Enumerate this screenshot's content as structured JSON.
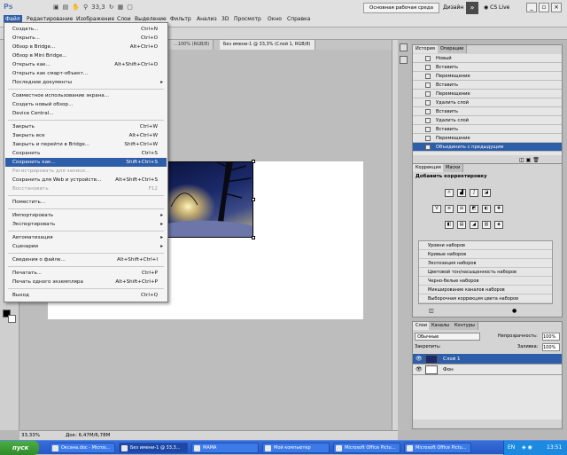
{
  "app": {
    "logo": "Ps",
    "zoom": "33,3",
    "workspace": "Основная рабочая среда",
    "design": "Дизайн",
    "cslive": "CS Live"
  },
  "menubar": [
    "Файл",
    "Редактирование",
    "Изображение",
    "Слои",
    "Выделение",
    "Фильтр",
    "Анализ",
    "3D",
    "Просмотр",
    "Окно",
    "Справка"
  ],
  "tabs": [
    "...100% (RGB/8)",
    "Без имени-1 @ 33,3% (Слой 1, RGB/8)"
  ],
  "status": {
    "zoom": "33,33%",
    "doc": "Док: 6,47M/6,78M"
  },
  "file_menu": [
    {
      "label": "Создать...",
      "shortcut": "Ctrl+N"
    },
    {
      "label": "Открыть...",
      "shortcut": "Ctrl+O"
    },
    {
      "label": "Обзор в Bridge...",
      "shortcut": "Alt+Ctrl+O"
    },
    {
      "label": "Обзор в Mini Bridge...",
      "shortcut": ""
    },
    {
      "label": "Открыть как...",
      "shortcut": "Alt+Shift+Ctrl+O"
    },
    {
      "label": "Открыть как смарт-объект...",
      "shortcut": ""
    },
    {
      "label": "Последние документы",
      "shortcut": "",
      "sub": "▸"
    },
    {
      "label": "Совместное использование экрана...",
      "shortcut": ""
    },
    {
      "label": "Создать новый обзор...",
      "shortcut": ""
    },
    {
      "label": "Device Central...",
      "shortcut": ""
    },
    {
      "label": "Закрыть",
      "shortcut": "Ctrl+W"
    },
    {
      "label": "Закрыть все",
      "shortcut": "Alt+Ctrl+W"
    },
    {
      "label": "Закрыть и перейти в Bridge...",
      "shortcut": "Shift+Ctrl+W"
    },
    {
      "label": "Сохранить",
      "shortcut": "Ctrl+S"
    },
    {
      "label": "Сохранить как...",
      "shortcut": "Shift+Ctrl+S"
    },
    {
      "label": "Регистрировать для записи...",
      "shortcut": ""
    },
    {
      "label": "Сохранить для Web и устройств...",
      "shortcut": "Alt+Shift+Ctrl+S"
    },
    {
      "label": "Восстановить",
      "shortcut": "F12"
    },
    {
      "label": "Поместить...",
      "shortcut": ""
    },
    {
      "label": "Импортировать",
      "shortcut": "",
      "sub": "▸"
    },
    {
      "label": "Экспортировать",
      "shortcut": "",
      "sub": "▸"
    },
    {
      "label": "Автоматизация",
      "shortcut": "",
      "sub": "▸"
    },
    {
      "label": "Сценарии",
      "shortcut": "",
      "sub": "▸"
    },
    {
      "label": "Сведения о файле...",
      "shortcut": "Alt+Shift+Ctrl+I"
    },
    {
      "label": "Печатать...",
      "shortcut": "Ctrl+P"
    },
    {
      "label": "Печать одного экземпляра",
      "shortcut": "Alt+Shift+Ctrl+P"
    },
    {
      "label": "Выход",
      "shortcut": "Ctrl+Q"
    }
  ],
  "history": {
    "tabs": [
      "История",
      "Операции"
    ],
    "items": [
      "Новый",
      "Вставить",
      "Перемещение",
      "Вставить",
      "Перемещение",
      "Удалить слой",
      "Вставить",
      "Удалить слой",
      "Вставить",
      "Перемещение",
      "Объединить с предыдущим"
    ]
  },
  "adjustments": {
    "tabs": [
      "Коррекция",
      "Маски"
    ],
    "title": "Добавить корректировку",
    "presets": [
      "Уровни наборов",
      "Кривые наборов",
      "Экспозиция наборов",
      "Цветовой тон/насыщенность наборов",
      "Черно-белые наборов",
      "Микширование каналов наборов",
      "Выборочная коррекция цвета наборов"
    ]
  },
  "layers": {
    "tabs": [
      "Слои",
      "Каналы",
      "Контуры"
    ],
    "blend": "Обычные",
    "opacity_label": "Непрозрачность:",
    "opacity": "100%",
    "lock_label": "Закрепить:",
    "fill_label": "Заливка:",
    "fill": "100%",
    "items": [
      {
        "name": "Слой 1"
      },
      {
        "name": "Фон"
      }
    ]
  },
  "taskbar": {
    "start": "пуск",
    "tasks": [
      "Оксана.doc - Micros...",
      "Без имени-1 @ 33,3...",
      "МАМА",
      "Мой компьютер",
      "Microsoft Office Pictu...",
      "Microsoft Office Pictu..."
    ],
    "lang": "EN",
    "time": "13:51"
  }
}
